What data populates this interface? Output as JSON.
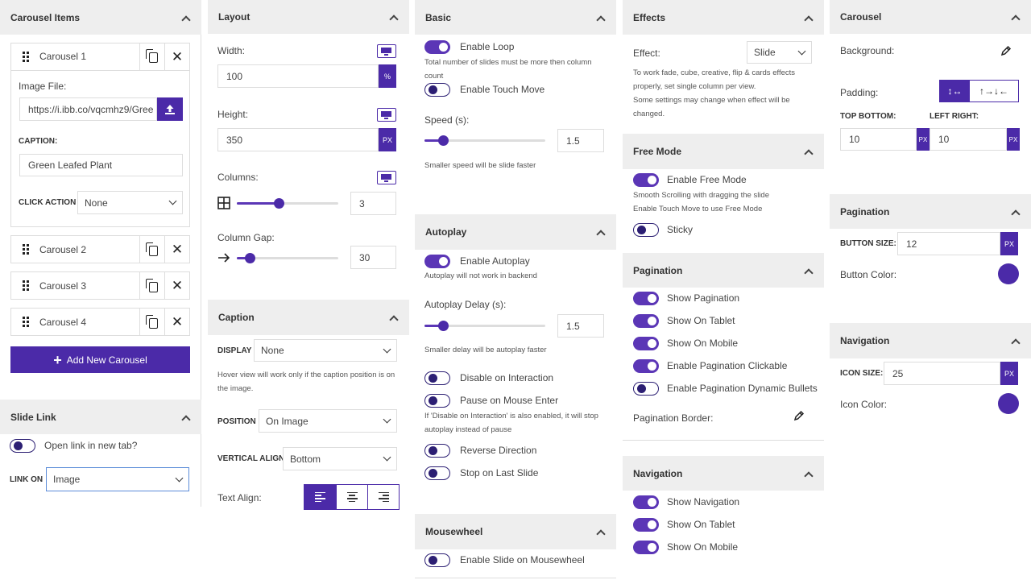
{
  "carousel_items": {
    "title": "Carousel Items",
    "items": [
      "Carousel 1",
      "Carousel 2",
      "Carousel 3",
      "Carousel 4"
    ],
    "image_file_label": "Image File:",
    "image_file_value": "https://i.ibb.co/vqcmhz9/Gree",
    "caption_label": "CAPTION:",
    "caption_value": "Green Leafed Plant",
    "click_action_label": "CLICK ACTION",
    "click_action_value": "None",
    "add_button": "Add New Carousel"
  },
  "slide_link": {
    "title": "Slide Link",
    "open_new_tab": "Open link in new tab?",
    "link_on_label": "LINK ON",
    "link_on_value": "Image"
  },
  "layout": {
    "title": "Layout",
    "width_label": "Width:",
    "width_value": "100",
    "width_unit": "%",
    "height_label": "Height:",
    "height_value": "350",
    "height_unit": "PX",
    "columns_label": "Columns:",
    "columns_value": "3",
    "gap_label": "Column Gap:",
    "gap_value": "30"
  },
  "caption": {
    "title": "Caption",
    "display_label": "DISPLAY",
    "display_value": "None",
    "display_note": "Hover view will work only if the caption position is on the image.",
    "position_label": "POSITION",
    "position_value": "On Image",
    "valign_label": "VERTICAL ALIGN",
    "valign_value": "Bottom",
    "text_align_label": "Text Align:"
  },
  "basic": {
    "title": "Basic",
    "enable_loop": "Enable Loop",
    "loop_note": "Total number of slides must be more then column count",
    "touch_move": "Enable Touch Move",
    "speed_label": "Speed (s):",
    "speed_value": "1.5",
    "speed_note": "Smaller speed will be slide faster"
  },
  "autoplay": {
    "title": "Autoplay",
    "enable": "Enable Autoplay",
    "enable_note": "Autoplay will not work in backend",
    "delay_label": "Autoplay Delay (s):",
    "delay_value": "1.5",
    "delay_note": "Smaller delay will be autoplay faster",
    "disable_interaction": "Disable on Interaction",
    "pause_mouse": "Pause on Mouse Enter",
    "pause_note": "If 'Disable on Interaction' is also enabled, it will stop autoplay instead of pause",
    "reverse": "Reverse Direction",
    "stop_last": "Stop on Last Slide"
  },
  "mousewheel": {
    "title": "Mousewheel",
    "enable": "Enable Slide on Mousewheel"
  },
  "effects": {
    "title": "Effects",
    "effect_label": "Effect:",
    "effect_value": "Slide",
    "note1": "To work fade, cube, creative, flip & cards effects properly, set single column per view.",
    "note2": "Some settings may change when effect will be changed."
  },
  "free_mode": {
    "title": "Free Mode",
    "enable": "Enable Free Mode",
    "note1": "Smooth Scrolling with dragging the slide",
    "note2": "Enable Touch Move to use Free Mode",
    "sticky": "Sticky"
  },
  "pagination_mid": {
    "title": "Pagination",
    "items": [
      "Show Pagination",
      "Show On Tablet",
      "Show On Mobile",
      "Enable Pagination Clickable",
      "Enable Pagination Dynamic Bullets"
    ],
    "border_label": "Pagination Border:"
  },
  "navigation_mid": {
    "title": "Navigation",
    "items": [
      "Show Navigation",
      "Show On Tablet",
      "Show On Mobile"
    ]
  },
  "carousel_style": {
    "title": "Carousel",
    "background_label": "Background:",
    "padding_label": "Padding:",
    "top_bottom_label": "TOP BOTTOM:",
    "top_bottom_value": "10",
    "top_bottom_unit": "PX",
    "left_right_label": "LEFT RIGHT:",
    "left_right_value": "10",
    "left_right_unit": "PX"
  },
  "pagination_style": {
    "title": "Pagination",
    "button_size_label": "BUTTON SIZE:",
    "button_size_value": "12",
    "button_size_unit": "PX",
    "button_color_label": "Button Color:"
  },
  "navigation_style": {
    "title": "Navigation",
    "icon_size_label": "ICON SIZE:",
    "icon_size_value": "25",
    "icon_size_unit": "PX",
    "icon_color_label": "Icon Color:"
  },
  "colors": {
    "accent": "#4b2aa8",
    "header_bg": "#eeeeee"
  }
}
